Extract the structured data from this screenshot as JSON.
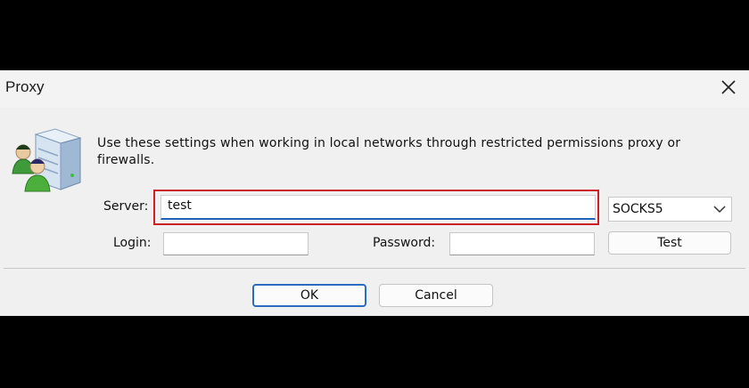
{
  "window": {
    "title": "Proxy",
    "close_icon": "close-icon"
  },
  "description": "Use these settings when working in local networks through restricted permissions proxy or firewalls.",
  "form": {
    "server_label": "Server:",
    "server_value": "test",
    "proxy_type": "SOCKS5",
    "login_label": "Login:",
    "login_value": "",
    "password_label": "Password:",
    "password_value": "",
    "test_button": "Test"
  },
  "buttons": {
    "ok": "OK",
    "cancel": "Cancel"
  },
  "colors": {
    "highlight": "#cc1f26",
    "focus_underline": "#1f63b8",
    "dialog_bg": "#f0f0f0"
  }
}
